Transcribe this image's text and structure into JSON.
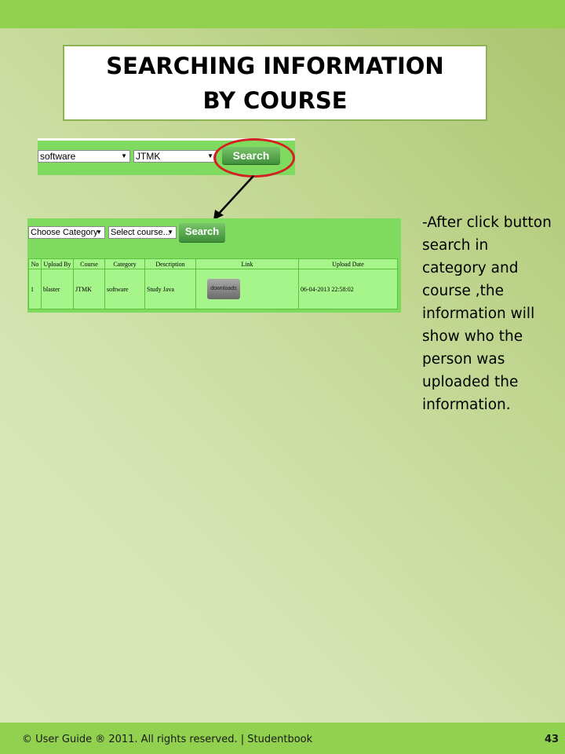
{
  "slide": {
    "title": "SEARCHING INFORMATION BY COURSE",
    "description": "-After click button search in category and course ,the information will show who the person was uploaded the information.",
    "footer": "© User Guide ® 2011. All rights reserved. | Studentbook",
    "page_number": "43"
  },
  "top_form": {
    "category_value": "software",
    "course_value": "JTMK",
    "search_label": "Search"
  },
  "result_form": {
    "category_value": "Choose Category",
    "course_value": "Select course...",
    "search_label": "Search"
  },
  "table": {
    "headers": [
      "No",
      "Upload By",
      "Course",
      "Category",
      "Description",
      "Link",
      "Upload Date"
    ],
    "rows": [
      {
        "no": "1",
        "upload_by": "blaster",
        "course": "JTMK",
        "category": "software",
        "description": "Study Java",
        "link_label": "downloads",
        "upload_date": "06-04-2013 22:58:02"
      }
    ]
  },
  "colors": {
    "bar": "#92d050",
    "highlight_circle": "#d42020",
    "panel": "#7fdb5f"
  }
}
